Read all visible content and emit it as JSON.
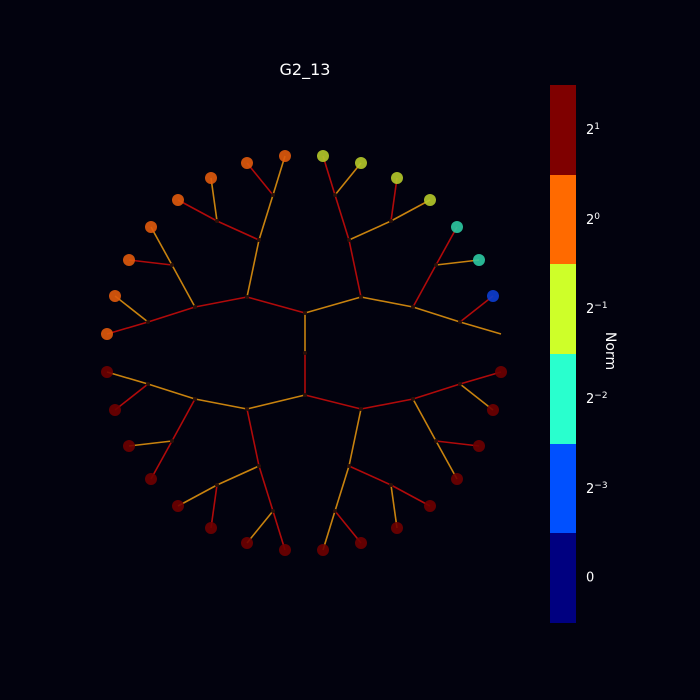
{
  "title": "G2_13",
  "colorbar": {
    "label": "Norm",
    "segments": [
      {
        "color": "#7f0000",
        "base": "2",
        "exp": "1"
      },
      {
        "color": "#ff6a00",
        "base": "2",
        "exp": "0"
      },
      {
        "color": "#ceff29",
        "base": "2",
        "exp": "−1"
      },
      {
        "color": "#29ffce",
        "base": "2",
        "exp": "−2"
      },
      {
        "color": "#0050ff",
        "base": "2",
        "exp": "−3"
      },
      {
        "color": "#000080",
        "base": "0",
        "exp": ""
      }
    ]
  },
  "edge_colors": {
    "a": "#c8820e",
    "b": "#b00a0a"
  },
  "leaf_colors": {
    "top_left": [
      "#e05a0c",
      "#e05a0c",
      "#e05a0c",
      "#e05a0c",
      "#e05a0c",
      "#e05a0c",
      "#e05a0c",
      "#e05a0c"
    ],
    "top_right": [
      "#b5c92a",
      "#b5c92a",
      "#b5c92a",
      "#b5c92a",
      "#2cc9a2",
      "#2cc9a2",
      "#0d3ed0",
      null
    ],
    "bottom_left": [
      "#6e0000",
      "#6e0000",
      "#6e0000",
      "#6e0000",
      "#6e0000",
      "#6e0000",
      "#6e0000",
      "#6e0000"
    ],
    "bottom_right": [
      "#6e0000",
      "#6e0000",
      "#6e0000",
      "#6e0000",
      "#6e0000",
      "#6e0000",
      "#6e0000",
      "#6e0000"
    ]
  }
}
